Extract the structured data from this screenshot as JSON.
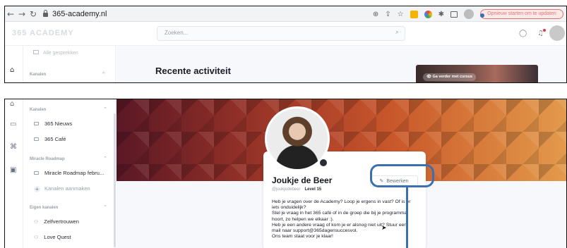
{
  "browser": {
    "url": "365-academy.nl",
    "update_button": "Opnieuw starten om te updaten"
  },
  "app": {
    "logo": "365 ACADEMY",
    "search_placeholder": "Zoeken..."
  },
  "top_panel": {
    "sidebar_faded_item": "Alle gesprekken",
    "sidebar_section": "Kanalen",
    "main_title": "Recente activiteit",
    "course_button": "Ga verder met cursus"
  },
  "sidebar": {
    "kanalen_header": "Kanalen",
    "kanalen_items": [
      "365 Nieuws",
      "365 Café"
    ],
    "roadmap_header": "Miracle Roadmap",
    "roadmap_items": [
      "Miracle Roadmap febru..."
    ],
    "create_channel": "Kanalen aanmaken",
    "eigen_header": "Eigen kanalen",
    "eigen_items": [
      "Zelfvertrouwen",
      "Love Quest"
    ]
  },
  "profile": {
    "name": "Joukje de Beer",
    "handle": "@joukjedebeer",
    "level": "Level 15",
    "edit_button": "Bewerken",
    "bio": [
      "Heb je vragen over de Academy? Loop je ergens in vast? Of is er",
      "iets onduidelijk?",
      "Stel je vraag in het 365 café of in de groep die bij je programma",
      "hoort, zo helpen we elkaar :).",
      "Heb je een andere vraag of kom je er alsnog niet uit? Stuur een",
      "mail naar support@365dagensuccesvol.",
      "Ons team staat voor je klaar!"
    ]
  },
  "colors": {
    "annotation_blue": "#3a6fb0",
    "banner_dark": "#5a1826",
    "banner_light": "#e39a4c",
    "update_red": "#e57373"
  },
  "icons": [
    "back-icon",
    "forward-icon",
    "reload-icon",
    "lock-icon",
    "zoom-icon",
    "share-icon",
    "star-icon",
    "puzzle-icon",
    "search-icon",
    "chat-icon",
    "bell-icon",
    "home-icon",
    "messages-icon",
    "graduation-icon",
    "calendar-icon",
    "channel-icon",
    "plus-icon",
    "people-icon",
    "pencil-icon",
    "camera-icon",
    "cursor-icon"
  ]
}
